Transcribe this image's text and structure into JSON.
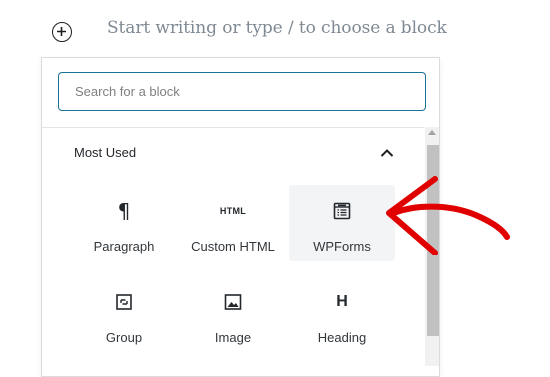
{
  "editor": {
    "placeholder": "Start writing or type / to choose a block"
  },
  "inserter": {
    "search_placeholder": "Search for a block",
    "section_title": "Most Used",
    "blocks": [
      {
        "label": "Paragraph",
        "icon": "paragraph-icon"
      },
      {
        "label": "Custom HTML",
        "icon": "html-icon",
        "icon_text": "HTML"
      },
      {
        "label": "WPForms",
        "icon": "wpforms-icon"
      },
      {
        "label": "Group",
        "icon": "group-icon"
      },
      {
        "label": "Image",
        "icon": "image-icon"
      },
      {
        "label": "Heading",
        "icon": "heading-icon",
        "icon_text": "H"
      }
    ]
  },
  "colors": {
    "focus_border": "#1a7296",
    "annotation_arrow": "#e00000",
    "hover_bg": "#f3f4f5"
  }
}
